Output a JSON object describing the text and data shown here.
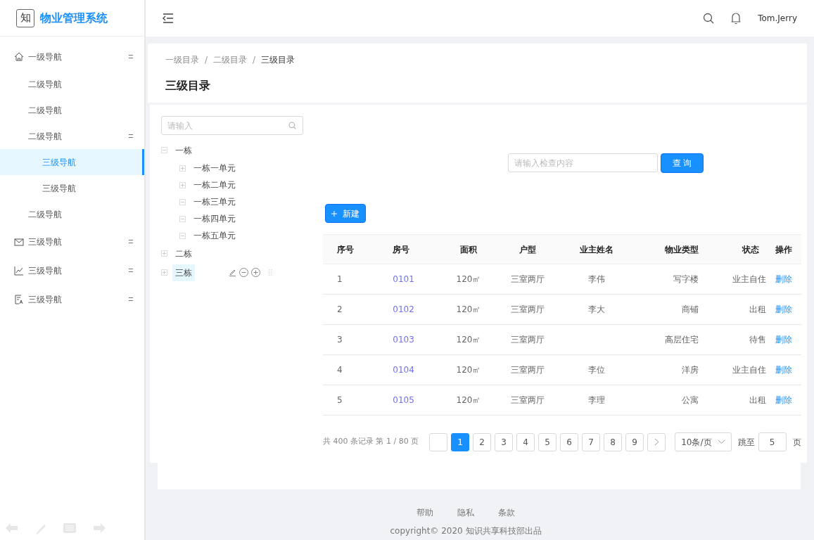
{
  "logo": {
    "mark": "知",
    "title": "物业管理系统"
  },
  "sidebar": {
    "items": [
      {
        "label": "一级导航",
        "kind": "group",
        "selected": false,
        "children": [
          {
            "label": "二级导航",
            "kind": "link",
            "selected": false
          },
          {
            "label": "二级导航",
            "kind": "link",
            "selected": false
          },
          {
            "label": "二级导航",
            "kind": "group",
            "selected": false,
            "children": [
              {
                "label": "三级导航",
                "selected": true
              },
              {
                "label": "三级导航",
                "selected": false
              }
            ]
          },
          {
            "label": "二级导航",
            "kind": "link",
            "selected": false
          }
        ]
      },
      {
        "label": "三级导航",
        "kind": "group",
        "selected": false
      },
      {
        "label": "三级导航",
        "kind": "group",
        "selected": false
      },
      {
        "label": "三级导航",
        "kind": "group",
        "selected": false
      }
    ]
  },
  "header": {
    "user": "Tom.Jerry"
  },
  "breadcrumb": [
    "一级目录",
    "二级目录",
    "三级目录"
  ],
  "breadcrumb_separator": "/",
  "page_title": "三级目录",
  "tree": {
    "placeholder": "请输入",
    "nodes": [
      {
        "label": "一栋",
        "expanded": true,
        "selected": false,
        "children": [
          {
            "label": "一栋一单元",
            "expanded": false,
            "selected": false
          },
          {
            "label": "一栋二单元",
            "expanded": false,
            "selected": false
          },
          {
            "label": "一栋三单元",
            "expanded": true,
            "selected": false
          },
          {
            "label": "一栋四单元",
            "expanded": true,
            "selected": false
          },
          {
            "label": "一栋五单元",
            "expanded": true,
            "selected": false
          }
        ]
      },
      {
        "label": "二栋",
        "expanded": false,
        "selected": false
      },
      {
        "label": "三栋",
        "expanded": false,
        "selected": true
      }
    ]
  },
  "query": {
    "placeholder": "请输入检查内容",
    "button": "查 询"
  },
  "new_button": "新建",
  "table": {
    "columns": [
      "序号",
      "房号",
      "面积",
      "户型",
      "业主姓名",
      "物业类型",
      "状态",
      "操作"
    ],
    "rows": [
      {
        "no": "1",
        "room": "0101",
        "area": "120㎡",
        "layout": "三室两厅",
        "owner": "李伟",
        "type": "写字楼",
        "status": "业主自住",
        "action": "删除"
      },
      {
        "no": "2",
        "room": "0102",
        "area": "120㎡",
        "layout": "三室两厅",
        "owner": "李大",
        "type": "商铺",
        "status": "出租",
        "action": "删除"
      },
      {
        "no": "3",
        "room": "0103",
        "area": "120㎡",
        "layout": "三室两厅",
        "type": "高层住宅",
        "status": "待售",
        "action": "删除"
      },
      {
        "no": "4",
        "room": "0104",
        "area": "120㎡",
        "layout": "三室两厅",
        "owner": "李位",
        "type": "洋房",
        "status": "业主自住",
        "action": "删除"
      },
      {
        "no": "5",
        "room": "0105",
        "area": "120㎡",
        "layout": "三室两厅",
        "owner": "李理",
        "type": "公寓",
        "status": "出租",
        "action": "删除"
      }
    ]
  },
  "pagination": {
    "summary": "共 400 条记录 第 1 / 80 页",
    "pages": [
      {
        "label": "1",
        "selected": true
      },
      {
        "label": "2",
        "selected": false
      },
      {
        "label": "3",
        "selected": false
      },
      {
        "label": "4",
        "selected": false
      },
      {
        "label": "5",
        "selected": false
      },
      {
        "label": "6",
        "selected": false
      },
      {
        "label": "7",
        "selected": false
      },
      {
        "label": "8",
        "selected": false
      },
      {
        "label": "9",
        "selected": false
      }
    ],
    "page_size": "10条/页",
    "jump_label": "跳至",
    "jump_value": "5",
    "jump_suffix": "页"
  },
  "footer": {
    "links": [
      "帮助",
      "隐私",
      "条款"
    ],
    "copyright": "copyright© 2020 知识共享科技部出品"
  }
}
